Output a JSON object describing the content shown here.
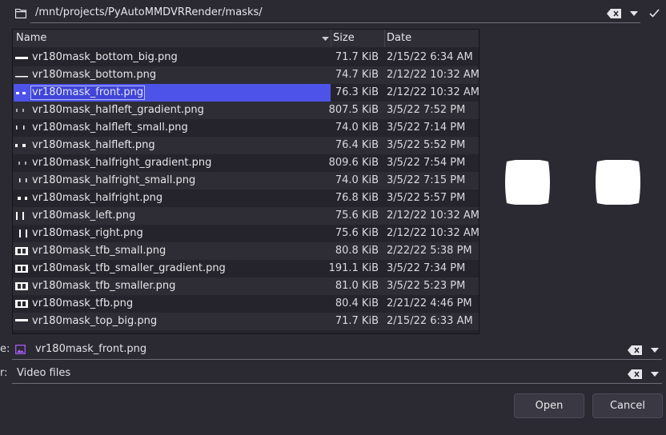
{
  "pathbar": {
    "path": "/mnt/projects/PyAutoMMDVRRender/masks/",
    "folder_icon": "folder-icon",
    "clear_icon": "backspace-clear-icon",
    "dropdown_icon": "chevron-down-icon",
    "confirm_icon": "checkmark-icon"
  },
  "columns": {
    "name": "Name",
    "size": "Size",
    "date": "Date"
  },
  "files": [
    {
      "name": "vr180mask_bottom_big.png",
      "size": "71.7 KiB",
      "date": "2/15/22 6:34 AM",
      "thumb": "bottom-bar"
    },
    {
      "name": "vr180mask_bottom.png",
      "size": "74.7 KiB",
      "date": "2/12/22 10:32 AM",
      "thumb": "bottom-line"
    },
    {
      "name": "vr180mask_front.png",
      "size": "76.3 KiB",
      "date": "2/12/22 10:32 AM",
      "thumb": "front",
      "selected": true
    },
    {
      "name": "vr180mask_halfleft_gradient.png",
      "size": "807.5 KiB",
      "date": "3/5/22 7:52 PM",
      "thumb": "halfleft-gradient"
    },
    {
      "name": "vr180mask_halfleft_small.png",
      "size": "74.0 KiB",
      "date": "3/5/22 7:14 PM",
      "thumb": "halfleft-small"
    },
    {
      "name": "vr180mask_halfleft.png",
      "size": "76.4 KiB",
      "date": "3/5/22 5:52 PM",
      "thumb": "halfleft"
    },
    {
      "name": "vr180mask_halfright_gradient.png",
      "size": "809.6 KiB",
      "date": "3/5/22 7:54 PM",
      "thumb": "halfright-gradient"
    },
    {
      "name": "vr180mask_halfright_small.png",
      "size": "74.0 KiB",
      "date": "3/5/22 7:15 PM",
      "thumb": "halfright-small"
    },
    {
      "name": "vr180mask_halfright.png",
      "size": "76.8 KiB",
      "date": "3/5/22 5:57 PM",
      "thumb": "halfright"
    },
    {
      "name": "vr180mask_left.png",
      "size": "75.6 KiB",
      "date": "2/12/22 10:32 AM",
      "thumb": "left"
    },
    {
      "name": "vr180mask_right.png",
      "size": "75.6 KiB",
      "date": "2/12/22 10:32 AM",
      "thumb": "right"
    },
    {
      "name": "vr180mask_tfb_small.png",
      "size": "80.8 KiB",
      "date": "2/22/22 5:38 PM",
      "thumb": "tfb"
    },
    {
      "name": "vr180mask_tfb_smaller_gradient.png",
      "size": "191.1 KiB",
      "date": "3/5/22 7:34 PM",
      "thumb": "tfb"
    },
    {
      "name": "vr180mask_tfb_smaller.png",
      "size": "81.0 KiB",
      "date": "3/5/22 5:23 PM",
      "thumb": "tfb"
    },
    {
      "name": "vr180mask_tfb.png",
      "size": "80.4 KiB",
      "date": "2/21/22 4:46 PM",
      "thumb": "tfb"
    },
    {
      "name": "vr180mask_top_big.png",
      "size": "71.7 KiB",
      "date": "2/15/22 6:33 AM",
      "thumb": "top-bar"
    }
  ],
  "name_field": {
    "label": "e:",
    "value": "vr180mask_front.png",
    "icon": "image-file-icon"
  },
  "filter_field": {
    "label": "r:",
    "value": "Video files"
  },
  "buttons": {
    "open": "Open",
    "cancel": "Cancel"
  },
  "colors": {
    "background": "#2b2a33",
    "selection": "#4d53e8",
    "list_bg": "#25242c"
  }
}
